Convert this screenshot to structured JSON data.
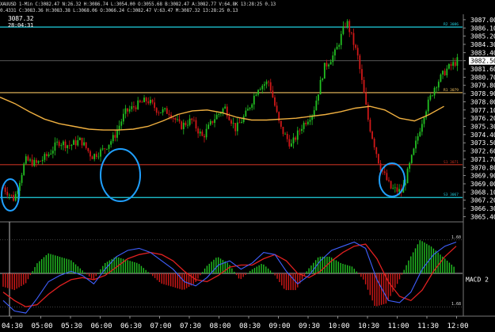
{
  "header": {
    "line1": "XAUUSD 1-Min C:3082.47 N:26.32 H:3086.74 L:3054.00 O:3055.68 B:3082.47 A:3082.77 V:64.8K 13:28:25 0.13",
    "line2": "0.4331 C:3083.36 H:3083.38 L:3068.06 O:3066.24 C:3082.47 V:63.47 M:3087.32 13:28:25 0.13",
    "crosshair_price": "3087.32",
    "crosshair_time": "28:04:31"
  },
  "colors": {
    "background": "#000000",
    "up_candle": "#22c022",
    "down_candle": "#d01818",
    "ma_line": "#f0b040",
    "level_cyan": "#20d0e0",
    "level_orange": "#f0c060",
    "level_red": "#c03020",
    "macd_fast": "#4060ff",
    "macd_slow": "#e02020",
    "circle": "#20a0ff"
  },
  "price_axis": {
    "labels": [
      "3087.00",
      "3086.10",
      "3085.20",
      "3084.30",
      "3083.40",
      "3082.50",
      "3081.60",
      "3080.70",
      "3079.80",
      "3078.90",
      "3078.00",
      "3077.10",
      "3076.20",
      "3075.30",
      "3074.40",
      "3073.50",
      "3072.60",
      "3071.70",
      "3070.80",
      "3069.90",
      "3069.00",
      "3068.10",
      "3067.20",
      "3066.30",
      "3065.40"
    ],
    "current_price_label": "3082.50"
  },
  "time_axis": {
    "labels": [
      "04:30",
      "05:00",
      "05:30",
      "06:00",
      "06:30",
      "07:00",
      "07:30",
      "08:00",
      "08:30",
      "09:00",
      "09:30",
      "10:00",
      "10:30",
      "11:00",
      "11:30",
      "12:00"
    ]
  },
  "levels": [
    {
      "name": "R2",
      "label": "R2 3086",
      "price": 3086.2,
      "color": "#20d0e0"
    },
    {
      "name": "R1",
      "label": "R1 3079",
      "price": 3079.0,
      "color": "#f0c060"
    },
    {
      "name": "S1",
      "label": "S1 3071",
      "price": 3071.1,
      "color": "#c03020"
    },
    {
      "name": "S2",
      "label": "S3 3067",
      "price": 3067.5,
      "color": "#20d0e0"
    }
  ],
  "macd_panel": {
    "label": "MACD 2",
    "upper_level": "1.60",
    "lower_level": "1.68"
  },
  "chart_data": {
    "type": "candlestick",
    "title": "",
    "x": [
      "04:30",
      "05:00",
      "05:30",
      "06:00",
      "06:30",
      "07:00",
      "07:30",
      "08:00",
      "08:30",
      "09:00",
      "09:30",
      "10:00",
      "10:30",
      "11:00",
      "11:30",
      "12:00"
    ],
    "close_path": [
      3068.6,
      3067.3,
      3071.6,
      3071.2,
      3072.1,
      3073.6,
      3073.2,
      3073.8,
      3072.0,
      3072.7,
      3074.1,
      3076.8,
      3077.6,
      3078.2,
      3077.0,
      3076.9,
      3075.3,
      3076.0,
      3074.1,
      3076.1,
      3077.4,
      3075.0,
      3076.8,
      3079.6,
      3080.2,
      3075.2,
      3073.2,
      3075.4,
      3076.9,
      3081.8,
      3083.4,
      3086.9,
      3083.0,
      3075.7,
      3071.0,
      3068.5,
      3068.1,
      3072.3,
      3076.7,
      3079.8,
      3081.5,
      3082.5
    ],
    "moving_average": [
      3078.5,
      3077.8,
      3076.9,
      3076.1,
      3075.6,
      3075.3,
      3075.0,
      3074.9,
      3074.9,
      3075.0,
      3075.3,
      3075.9,
      3076.6,
      3077.0,
      3077.1,
      3076.8,
      3076.3,
      3076.0,
      3076.0,
      3076.1,
      3076.2,
      3076.4,
      3076.6,
      3076.9,
      3077.3,
      3077.5,
      3077.1,
      3076.2,
      3075.9,
      3076.6,
      3077.5
    ],
    "macd": [
      -1.3,
      -1.8,
      -1.9,
      -1.2,
      -0.4,
      -0.1,
      0.1,
      -0.1,
      -0.5,
      0.2,
      0.8,
      1.1,
      1.2,
      1.0,
      0.6,
      0.2,
      -0.4,
      -0.6,
      -0.2,
      0.4,
      0.6,
      0.2,
      0.5,
      1.0,
      0.9,
      0.1,
      -0.5,
      -0.1,
      0.6,
      1.1,
      1.3,
      1.5,
      1.2,
      -0.3,
      -1.3,
      -1.4,
      -0.9,
      0.2,
      0.9,
      1.3,
      1.5
    ],
    "signal": [
      -0.9,
      -1.3,
      -1.6,
      -1.5,
      -1.0,
      -0.6,
      -0.3,
      -0.2,
      -0.3,
      -0.1,
      0.3,
      0.7,
      0.9,
      1.0,
      0.9,
      0.6,
      0.1,
      -0.3,
      -0.4,
      -0.1,
      0.3,
      0.4,
      0.4,
      0.7,
      0.9,
      0.6,
      0.0,
      -0.2,
      0.1,
      0.6,
      1.0,
      1.3,
      1.4,
      0.7,
      -0.4,
      -1.1,
      -1.3,
      -0.8,
      0.1,
      0.8,
      1.3
    ],
    "ylim": [
      3065.0,
      3087.6
    ],
    "grid": false
  }
}
